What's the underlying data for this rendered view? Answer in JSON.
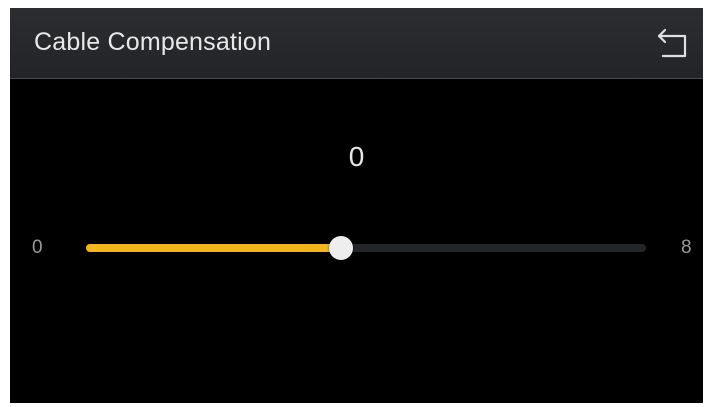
{
  "header": {
    "title": "Cable Compensation",
    "back_icon": "return-arrow-icon"
  },
  "setting": {
    "current_value": "0",
    "min_label": "0",
    "max_label": "8",
    "slider_level": 0.455
  },
  "colors": {
    "accent": "#f2b619",
    "background": "#000000",
    "header_background": "#2b2d30",
    "track": "#232529",
    "thumb": "#eeeeee",
    "text": "#e8e8e8",
    "muted_text": "#9a9a9a"
  }
}
